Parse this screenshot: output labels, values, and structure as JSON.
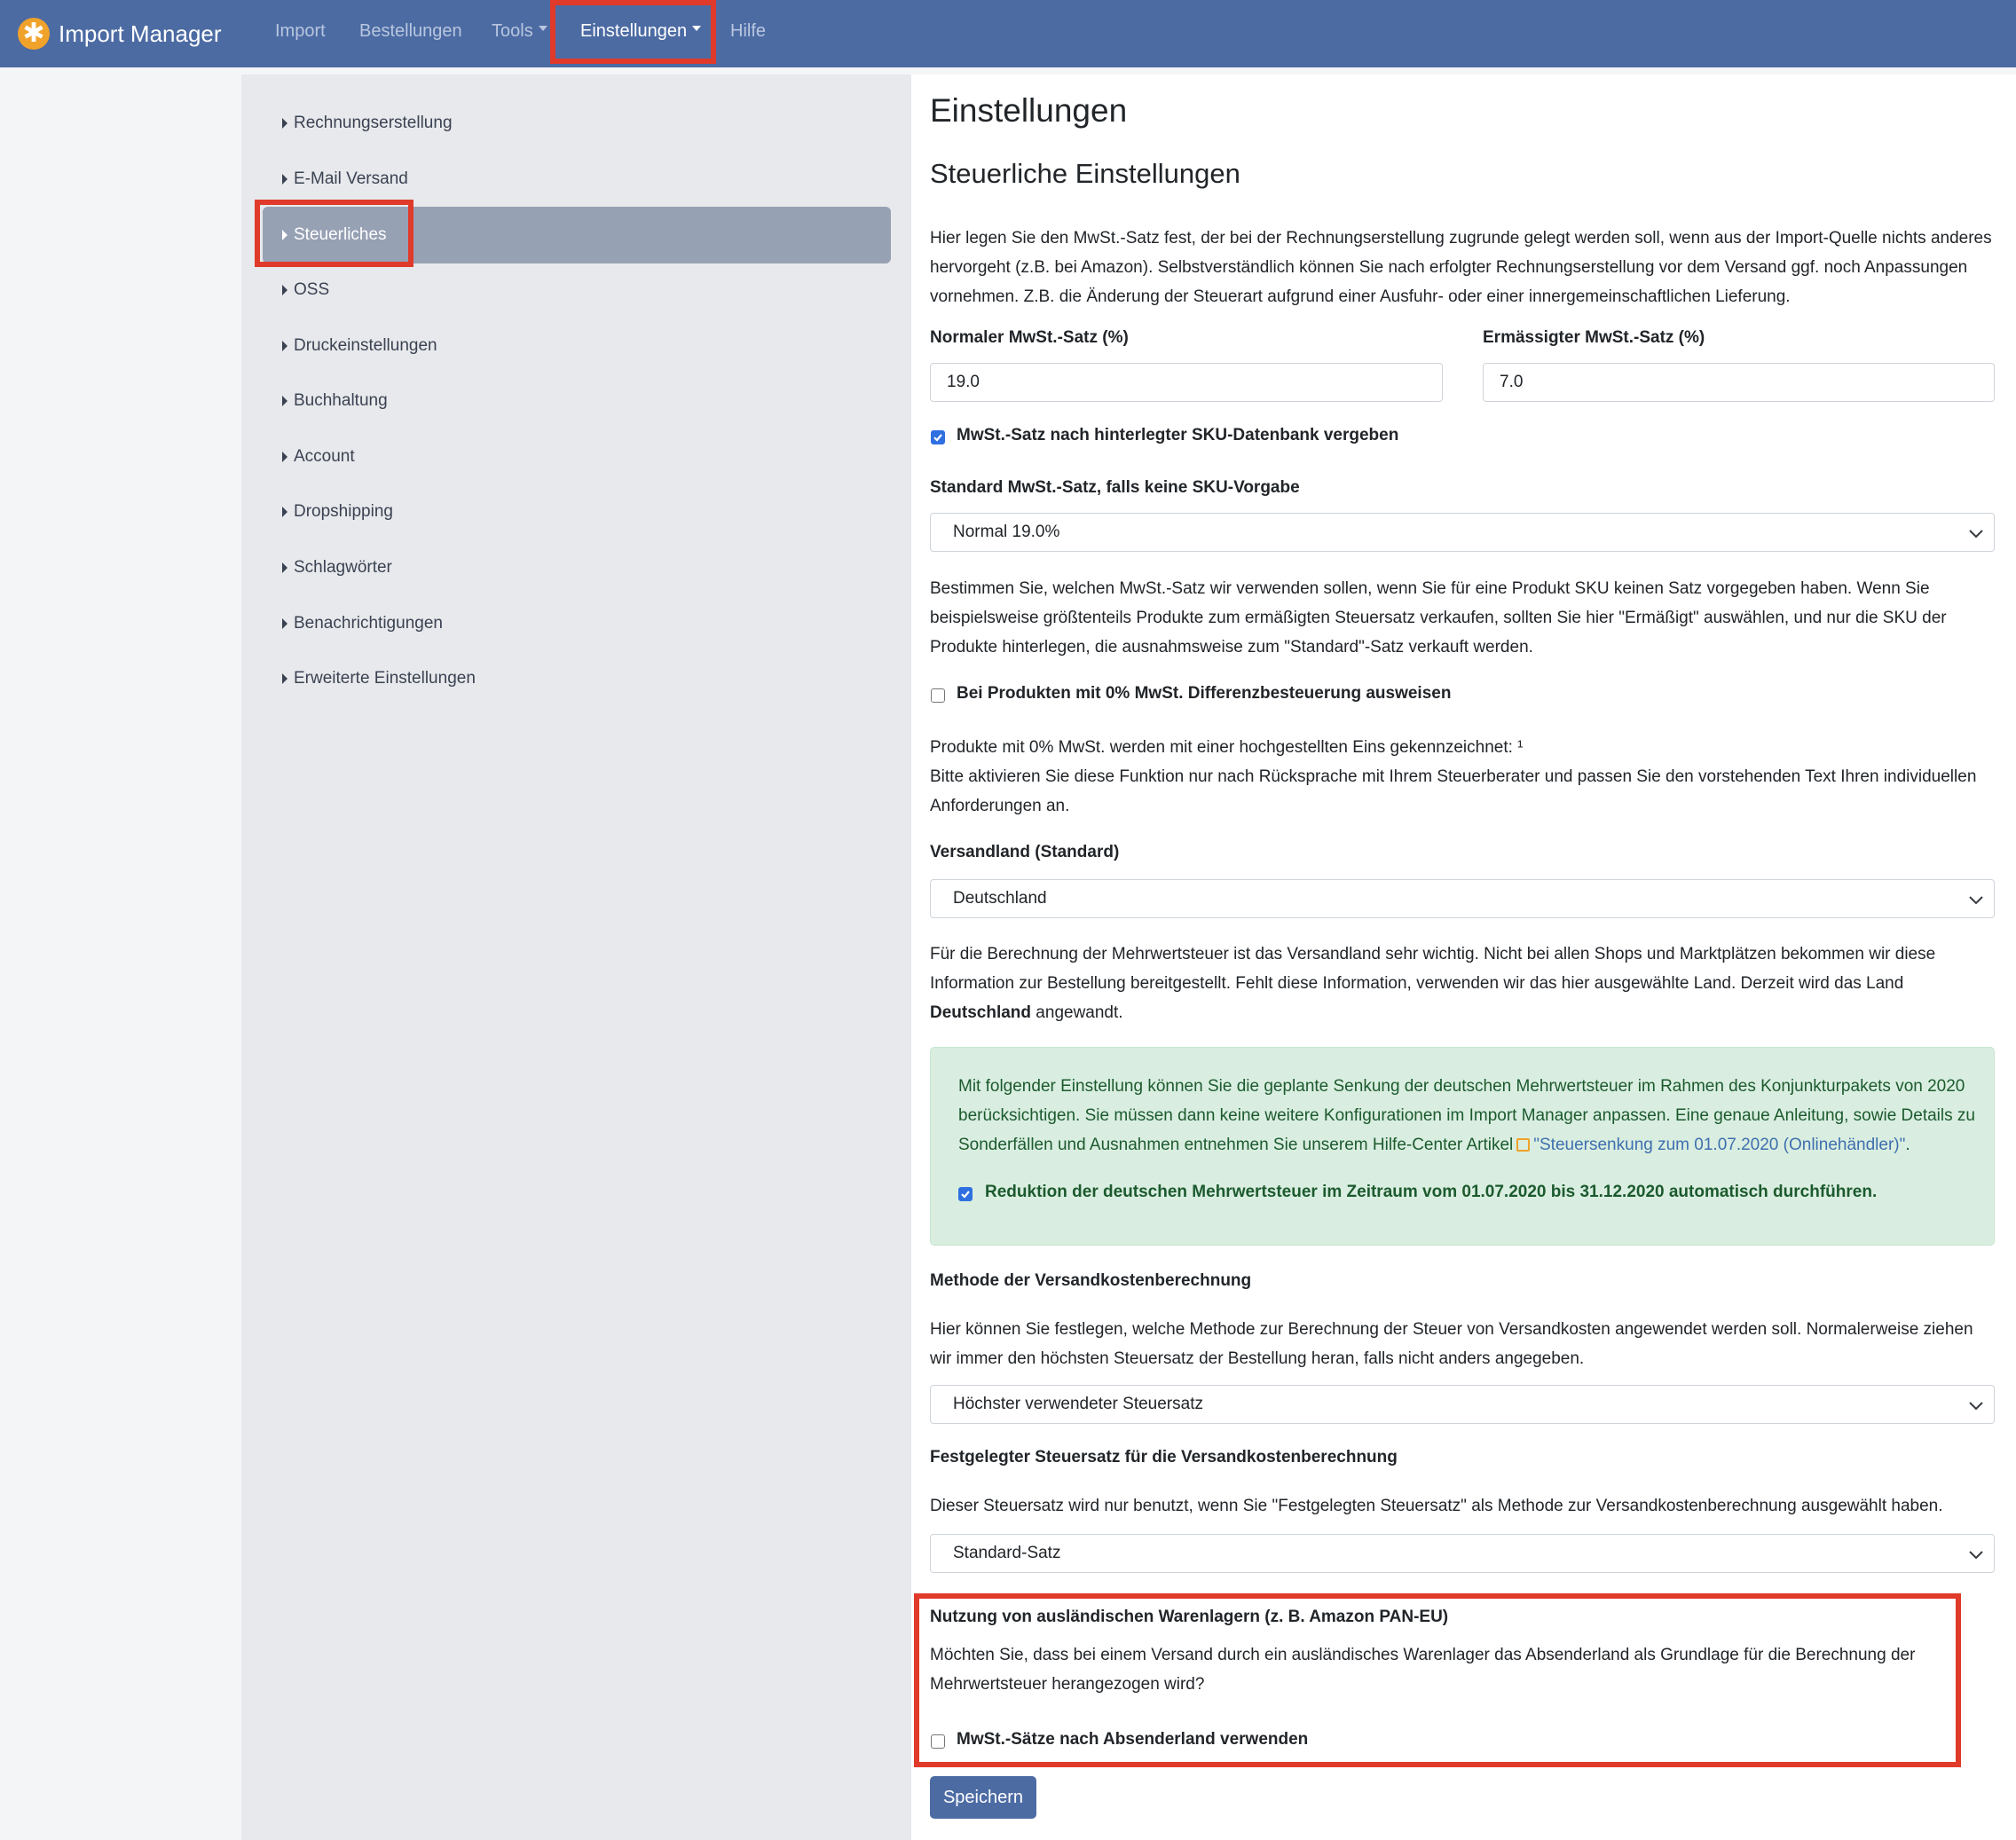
{
  "navbar": {
    "brand": "Import Manager",
    "items": [
      "Import",
      "Bestellungen",
      "Tools",
      "Einstellungen",
      "Hilfe"
    ]
  },
  "sidebar": {
    "items": [
      "Rechnungserstellung",
      "E-Mail Versand",
      "Steuerliches",
      "OSS",
      "Druckeinstellungen",
      "Buchhaltung",
      "Account",
      "Dropshipping",
      "Schlagwörter",
      "Benachrichtigungen",
      "Erweiterte Einstellungen"
    ],
    "active": "Steuerliches"
  },
  "main": {
    "title": "Einstellungen",
    "subtitle": "Steuerliche Einstellungen",
    "intro": "Hier legen Sie den MwSt.-Satz fest, der bei der Rechnungserstellung zugrunde gelegt werden soll, wenn aus der Import-Quelle nichts anderes hervorgeht (z.B. bei Amazon). Selbstverständlich können Sie nach erfolgter Rechnungserstellung vor dem Versand ggf. noch Anpassungen vornehmen. Z.B. die Änderung der Steuerart aufgrund einer Ausfuhr- oder einer innergemeinschaftlichen Lieferung.",
    "normal_rate_label": "Normaler MwSt.-Satz (%)",
    "normal_rate_value": "19.0",
    "reduced_rate_label": "Ermässigter MwSt.-Satz (%)",
    "reduced_rate_value": "7.0",
    "sku_checkbox_label": "MwSt.-Satz nach hinterlegter SKU-Datenbank vergeben",
    "sku_checkbox_checked": true,
    "default_rate_label": "Standard MwSt.-Satz, falls keine SKU-Vorgabe",
    "default_rate_value": "Normal 19.0%",
    "default_rate_help": "Bestimmen Sie, welchen MwSt.-Satz wir verwenden sollen, wenn Sie für eine Produkt SKU keinen Satz vorgegeben haben. Wenn Sie beispielsweise größtenteils Produkte zum ermäßigten Steuersatz verkaufen, sollten Sie hier \"Ermäßigt\" auswählen, und nur die SKU der Produkte hinterlegen, die ausnahmsweise zum \"Standard\"-Satz verkauft werden.",
    "diff_checkbox_label": "Bei Produkten mit 0% MwSt. Differenzbesteuerung ausweisen",
    "diff_checkbox_checked": false,
    "diff_help_line1": "Produkte mit 0% MwSt. werden mit einer hochgestellten Eins gekennzeichnet: ¹",
    "diff_help_line2": "Bitte aktivieren Sie diese Funktion nur nach Rücksprache mit Ihrem Steuerberater und passen Sie den vorstehenden Text Ihren individuellen Anforderungen an.",
    "country_label": "Versandland (Standard)",
    "country_value": "Deutschland",
    "country_help_a": "Für die Berechnung der Mehrwertsteuer ist das Versandland sehr wichtig. Nicht bei allen Shops und Marktplätzen bekommen wir diese Information zur Bestellung bereitgestellt. Fehlt diese Information, verwenden wir das hier ausgewählte Land. Derzeit wird das Land ",
    "country_help_bold": "Deutschland",
    "country_help_b": " angewandt.",
    "alert_text": "Mit folgender Einstellung können Sie die geplante Senkung der deutschen Mehrwertsteuer im Rahmen des Konjunkturpakets von 2020 berücksichtigen. Sie müssen dann keine weitere Konfigurationen im Import Manager anpassen. Eine genaue Anleitung, sowie Details zu Sonderfällen und Ausnahmen entnehmen Sie unserem Hilfe-Center Artikel",
    "alert_link": "\"Steuersenkung zum 01.07.2020 (Onlinehändler)\"",
    "alert_end": ".",
    "alert_checkbox_label": "Reduktion der deutschen Mehrwertsteuer im Zeitraum vom 01.07.2020 bis 31.12.2020 automatisch durchführen.",
    "alert_checkbox_checked": true,
    "shipping_method_label": "Methode der Versandkostenberechnung",
    "shipping_method_help": "Hier können Sie festlegen, welche Methode zur Berechnung der Steuer von Versandkosten angewendet werden soll. Normalerweise ziehen wir immer den höchsten Steuersatz der Bestellung heran, falls nicht anders angegeben.",
    "shipping_method_value": "Höchster verwendeter Steuersatz",
    "fixed_rate_label": "Festgelegter Steuersatz für die Versandkostenberechnung",
    "fixed_rate_help": "Dieser Steuersatz wird nur benutzt, wenn Sie \"Festgelegten Steuersatz\" als Methode zur Versandkostenberechnung ausgewählt haben.",
    "fixed_rate_value": "Standard-Satz",
    "warehouse_label": "Nutzung von ausländischen Warenlagern (z. B. Amazon PAN-EU)",
    "warehouse_help": "Möchten Sie, dass bei einem Versand durch ein ausländisches Warenlager das Absenderland als Grundlage für die Berechnung der Mehrwertsteuer herangezogen wird?",
    "warehouse_checkbox_label": "MwSt.-Sätze nach Absenderland verwenden",
    "warehouse_checkbox_checked": false,
    "save_label": "Speichern"
  },
  "colors": {
    "navbar": "#4c6ba3",
    "highlight": "#e03a2a",
    "alert_bg": "#d9eee0",
    "checkbox": "#2f6fe0"
  }
}
